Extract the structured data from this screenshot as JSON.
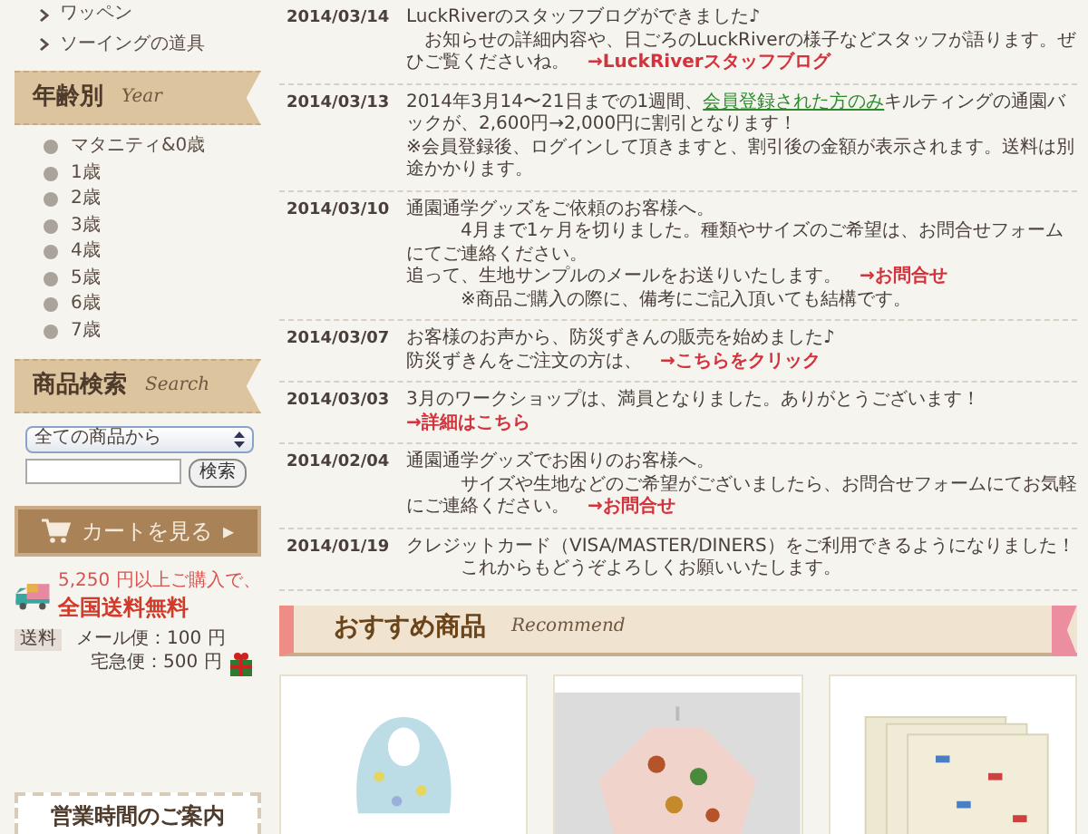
{
  "sidebar": {
    "categories": [
      "ワッペン",
      "ソーイングの道具"
    ],
    "year_banner": {
      "title": "年齢別",
      "subtitle": "Year"
    },
    "years": [
      "マタニティ&0歳",
      "1歳",
      "2歳",
      "3歳",
      "4歳",
      "5歳",
      "6歳",
      "7歳"
    ],
    "search_banner": {
      "title": "商品検索",
      "subtitle": "Search"
    },
    "search": {
      "select": "全ての商品から",
      "button": "検索"
    },
    "cart_button": {
      "label": "カートを見る",
      "arrow": "▸"
    },
    "shipping": {
      "threshold": "5,250 円以上ご購入で、",
      "headline": "全国送料無料",
      "tag": "送料",
      "rates": [
        "メール便：100 円",
        "宅急便：500 円"
      ]
    },
    "hours_title": "営業時間のご案内"
  },
  "news": [
    {
      "date": "2014/03/14",
      "lines": [
        [
          {
            "kind": "text",
            "text": "LuckRiverのスタッフブログができました♪"
          }
        ],
        [
          {
            "kind": "text",
            "text": "　お知らせの詳細内容や、日ごろのLuckRiverの様子などスタッフが語ります。ぜひご覧くださいね。　"
          },
          {
            "kind": "link",
            "text": "→LuckRiverスタッフブログ"
          }
        ]
      ]
    },
    {
      "date": "2014/03/13",
      "lines": [
        [
          {
            "kind": "text",
            "text": "2014年3月14〜21日までの1週間、"
          },
          {
            "kind": "member",
            "text": "会員登録された方のみ"
          },
          {
            "kind": "text",
            "text": "キルティングの通園バックが、2,600円→2,000円に割引となります！"
          }
        ],
        [
          {
            "kind": "text",
            "text": "※会員登録後、ログインして頂きますと、割引後の金額が表示されます。送料は別途かかります。"
          }
        ]
      ]
    },
    {
      "date": "2014/03/10",
      "lines": [
        [
          {
            "kind": "text",
            "text": "通園通学グッズをご依頼のお客様へ。"
          }
        ],
        [
          {
            "kind": "text",
            "text": "　　　4月まで1ヶ月を切りました。種類やサイズのご希望は、お問合せフォームにてご連絡ください。"
          }
        ],
        [
          {
            "kind": "text",
            "text": "追って、生地サンプルのメールをお送りいたします。　"
          },
          {
            "kind": "link",
            "text": "→お問合せ"
          }
        ],
        [
          {
            "kind": "text",
            "text": "　　　※商品ご購入の際に、備考にご記入頂いても結構です。"
          }
        ]
      ]
    },
    {
      "date": "2014/03/07",
      "lines": [
        [
          {
            "kind": "text",
            "text": "お客様のお声から、防災ずきんの販売を始めました♪"
          }
        ],
        [
          {
            "kind": "text",
            "text": "防災ずきんをご注文の方は、　"
          },
          {
            "kind": "link",
            "text": "→こちらをクリック"
          }
        ]
      ]
    },
    {
      "date": "2014/03/03",
      "lines": [
        [
          {
            "kind": "text",
            "text": "3月のワークショップは、満員となりました。ありがとうございます！　"
          },
          {
            "kind": "link",
            "text": "→詳細はこちら"
          }
        ]
      ]
    },
    {
      "date": "2014/02/04",
      "lines": [
        [
          {
            "kind": "text",
            "text": "通園通学グッズでお困りのお客様へ。"
          }
        ],
        [
          {
            "kind": "text",
            "text": "　　　サイズや生地などのご希望がございましたら、お問合せフォームにてお気軽にご連絡ください。　"
          },
          {
            "kind": "link",
            "text": "→お問合せ"
          }
        ]
      ]
    },
    {
      "date": "2014/01/19",
      "lines": [
        [
          {
            "kind": "text",
            "text": "クレジットカード（VISA/MASTER/DINERS）をご利用できるようになりました！"
          }
        ],
        [
          {
            "kind": "text",
            "text": "　　　これからもどうぞよろしくお願いいたします。"
          }
        ]
      ]
    }
  ],
  "recommend_banner": {
    "title": "おすすめ商品",
    "subtitle": "Recommend"
  },
  "products": [
    {
      "kind": "bib"
    },
    {
      "kind": "smock"
    },
    {
      "kind": "cloth"
    }
  ]
}
